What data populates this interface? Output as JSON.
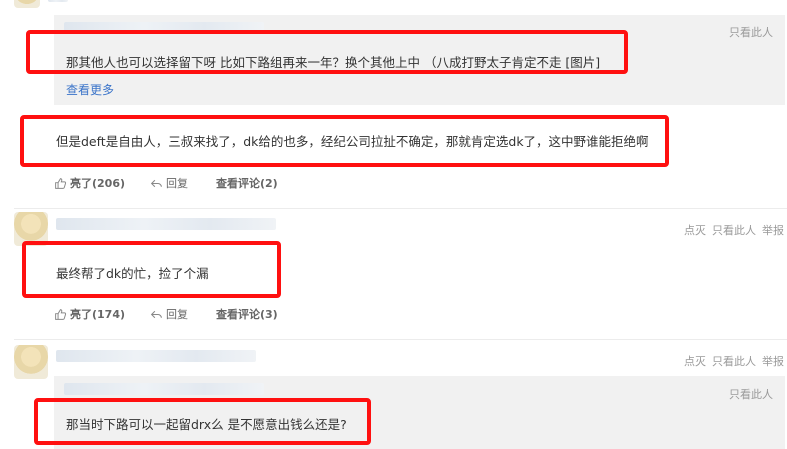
{
  "comments": [
    {
      "reply_text": "那其他人也可以选择留下呀 比如下路组再来一年？换个其他上中 （八成打野太子肯定不走 [图片]",
      "reply_meta": "只看此人",
      "see_more": "查看更多",
      "main_text": "但是deft是自由人，三叔来找了，dk给的也多，经纪公司拉扯不确定，那就肯定选dk了，这中野谁能拒绝啊",
      "like": "亮了(206)",
      "reply": "回复",
      "view_comments": "查看评论(2)"
    },
    {
      "meta_dislike": "点灭",
      "meta_only": "只看此人",
      "meta_report": "举报",
      "main_text": "最终帮了dk的忙，捡了个漏",
      "like": "亮了(174)",
      "reply": "回复",
      "view_comments": "查看评论(3)"
    },
    {
      "meta_dislike": "点灭",
      "meta_only": "只看此人",
      "meta_report": "举报",
      "reply_meta": "只看此人",
      "reply_text": "那当时下路可以一起留drx么 是不愿意出钱么还是?"
    }
  ],
  "icons": {
    "like": "thumbs-up-icon",
    "reply": "reply-arrow-icon"
  },
  "colors": {
    "highlight": "#ff1010",
    "link": "#3b74c9",
    "reply_bg": "#f1f1f1"
  }
}
